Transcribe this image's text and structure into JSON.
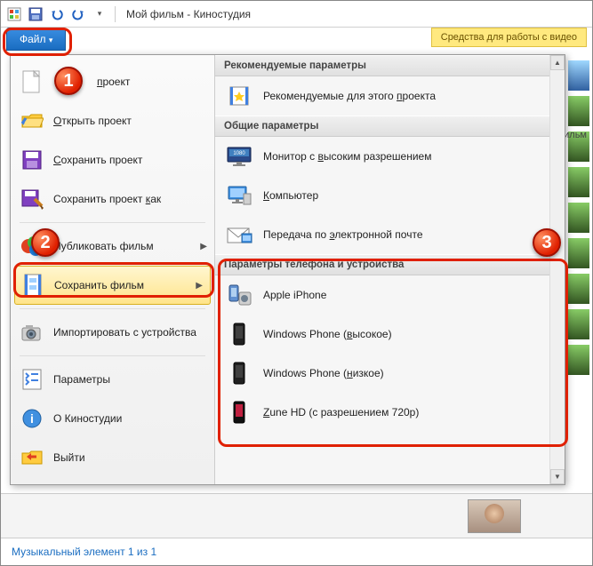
{
  "qat": {
    "title": "Мой фильм - Киностудия"
  },
  "ribbon": {
    "file_tab": "Файл",
    "context_tab": "Средства для работы с видео"
  },
  "badges": {
    "one": "1",
    "two": "2",
    "three": "3"
  },
  "menu": {
    "items": [
      {
        "label": "Создать проект"
      },
      {
        "label": "Открыть проект"
      },
      {
        "label": "Сохранить проект"
      },
      {
        "label": "Сохранить проект как"
      },
      {
        "label": "Публиковать фильм"
      },
      {
        "label": "Сохранить фильм"
      },
      {
        "label": "Импортировать с устройства"
      },
      {
        "label": "Параметры"
      },
      {
        "label": "О Киностудии"
      },
      {
        "label": "Выйти"
      }
    ]
  },
  "right": {
    "g1": "Рекомендуемые параметры",
    "r1": "Рекомендуемые для этого проекта",
    "g2": "Общие параметры",
    "r2": "Монитор с высоким разрешением",
    "r3": "Компьютер",
    "r4": "Передача по электронной почте",
    "g3": "Параметры телефона и устройства",
    "r5": "Apple iPhone",
    "r6": "Windows Phone (высокое)",
    "r7": "Windows Phone (низкое)",
    "r8": "Zune HD (с разрешением 720p)",
    "partial": "ильм"
  },
  "status": "Музыкальный элемент 1 из 1"
}
